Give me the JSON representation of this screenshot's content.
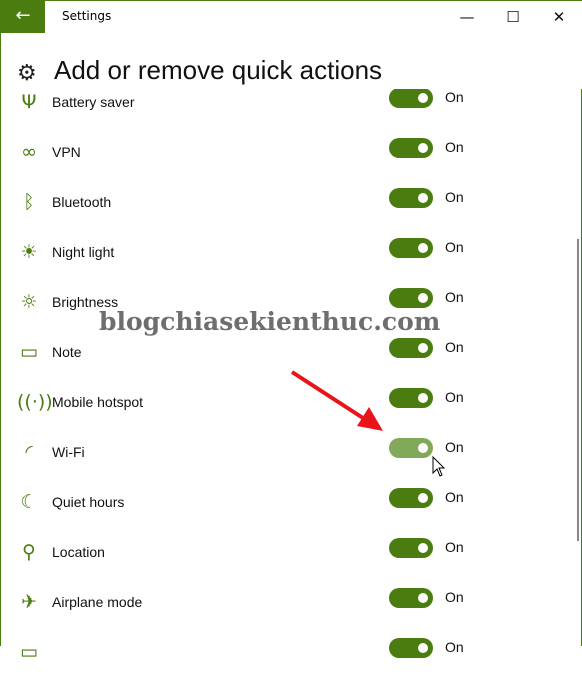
{
  "titlebar": {
    "title": "Settings",
    "back_icon": "arrow-left-icon",
    "minimize": "—",
    "maximize": "☐",
    "close": "✕"
  },
  "header": {
    "title": "Add or remove quick actions",
    "icon": "gear-icon"
  },
  "accent": "#4a7c10",
  "actions": [
    {
      "label": "Battery saver",
      "icon": "Ψ",
      "state": "On"
    },
    {
      "label": "VPN",
      "icon": "∞",
      "state": "On"
    },
    {
      "label": "Bluetooth",
      "icon": "ᛒ",
      "state": "On"
    },
    {
      "label": "Night light",
      "icon": "☀",
      "state": "On"
    },
    {
      "label": "Brightness",
      "icon": "☼",
      "state": "On"
    },
    {
      "label": "Note",
      "icon": "▭",
      "state": "On"
    },
    {
      "label": "Mobile hotspot",
      "icon": "((·))",
      "state": "On"
    },
    {
      "label": "Wi-Fi",
      "icon": "◜",
      "state": "On",
      "hovered": true
    },
    {
      "label": "Quiet hours",
      "icon": "☾",
      "state": "On"
    },
    {
      "label": "Location",
      "icon": "⚲",
      "state": "On"
    },
    {
      "label": "Airplane mode",
      "icon": "✈",
      "state": "On"
    },
    {
      "label": "",
      "icon": "▭",
      "state": "On"
    }
  ],
  "watermark": "blogchiasekienthuc.com"
}
